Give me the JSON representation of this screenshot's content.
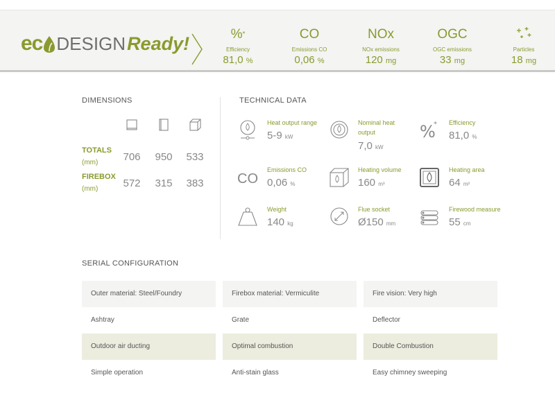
{
  "brand": {
    "eco_left": "ec",
    "eco_right": "",
    "design": "DESIGN",
    "ready": "Ready!"
  },
  "metrics": [
    {
      "symbol": "%",
      "label": "Efficiency",
      "value": "81,0",
      "unit": "%"
    },
    {
      "symbol": "CO",
      "label": "Emissions CO",
      "value": "0,06",
      "unit": "%"
    },
    {
      "symbol": "NOx",
      "label": "NOx emissions",
      "value": "120",
      "unit": "mg"
    },
    {
      "symbol": "OGC",
      "label": "OGC emissions",
      "value": "33",
      "unit": "mg"
    },
    {
      "symbol": "particles-icon",
      "label": "Particles",
      "value": "18",
      "unit": "mg"
    }
  ],
  "dimensions": {
    "title": "DIMENSIONS",
    "icons": [
      "width-icon",
      "height-icon",
      "depth-icon"
    ],
    "rows": [
      {
        "label": "TOTALS",
        "unit": "(mm)",
        "values": [
          "706",
          "950",
          "533"
        ]
      },
      {
        "label": "FIREBOX",
        "unit": "(mm)",
        "values": [
          "572",
          "315",
          "383"
        ]
      }
    ]
  },
  "technical": {
    "title": "TECHNICAL DATA",
    "items": [
      {
        "icon": "heat-output-icon",
        "label": "Heat output range",
        "value": "5-9",
        "unit": "kW"
      },
      {
        "icon": "nominal-heat-icon",
        "label": "Nominal heat output",
        "value": "7,0",
        "unit": "kW"
      },
      {
        "icon": "efficiency-icon",
        "label": "Efficiency",
        "value": "81,0",
        "unit": "%"
      },
      {
        "icon": "co-icon",
        "icon_text": "CO",
        "label": "Emissions CO",
        "value": "0,06",
        "unit": "%"
      },
      {
        "icon": "heating-volume-icon",
        "label": "Heating volume",
        "value": "160",
        "unit": "m³"
      },
      {
        "icon": "heating-area-icon",
        "label": "Heating area",
        "value": "64",
        "unit": "m²"
      },
      {
        "icon": "weight-icon",
        "label": "Weight",
        "value": "140",
        "unit": "kg"
      },
      {
        "icon": "flue-socket-icon",
        "label": "Flue socket",
        "value": "Ø150",
        "unit": "mm"
      },
      {
        "icon": "firewood-icon",
        "label": "Firewood measure",
        "value": "55",
        "unit": "cm"
      }
    ]
  },
  "serial": {
    "title": "SERIAL CONFIGURATION",
    "rows": [
      [
        "Outer material: Steel/Foundry",
        "Firebox material: Vermiculite",
        "Fire vision: Very high"
      ],
      [
        "Ashtray",
        "Grate",
        "Deflector"
      ],
      [
        "Outdoor air ducting",
        "Optimal combustion",
        "Double Combustion"
      ],
      [
        "Simple operation",
        "Anti-stain glass",
        "Easy chimney sweeping"
      ]
    ]
  },
  "colors": {
    "accent": "#8a9a2e",
    "row_light": "#f4f4f2",
    "row_tan": "#ecedde"
  }
}
